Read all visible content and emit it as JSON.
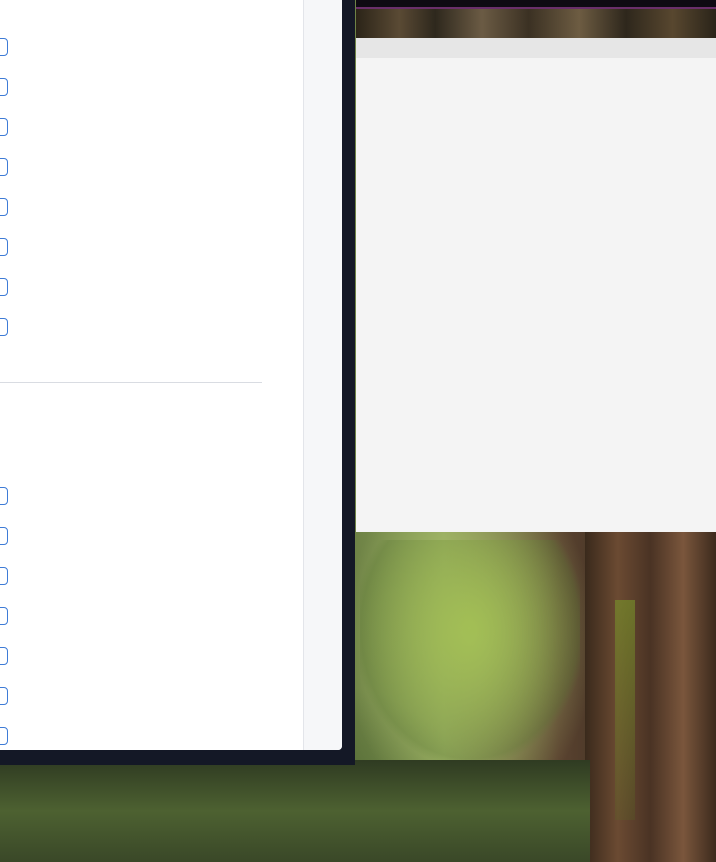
{
  "windows": {
    "left": {
      "checkbox_group_1_count": 8,
      "checkbox_group_2_count": 7
    }
  },
  "icons": [
    "checkbox-icon"
  ]
}
